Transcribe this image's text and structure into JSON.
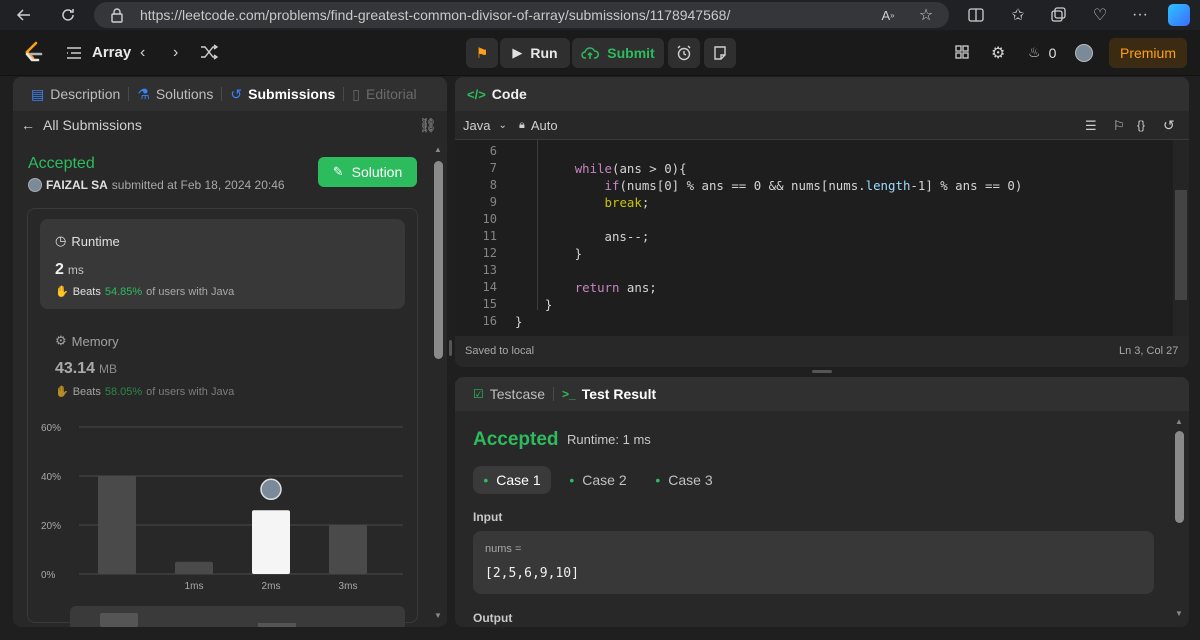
{
  "browser": {
    "url": "https://leetcode.com/problems/find-greatest-common-divisor-of-array/submissions/1178947568/"
  },
  "topbar": {
    "problem_list": "Array",
    "run_label": "Run",
    "submit_label": "Submit",
    "streak_count": "0",
    "premium_label": "Premium"
  },
  "left_tabs": [
    {
      "label": "Description"
    },
    {
      "label": "Solutions"
    },
    {
      "label": "Submissions"
    },
    {
      "label": "Editorial"
    }
  ],
  "submission": {
    "all_label": "All Submissions",
    "status": "Accepted",
    "user": "FAIZAL SA",
    "submitted_at": "submitted at Feb 18, 2024 20:46",
    "solution_label": "Solution"
  },
  "runtime": {
    "label": "Runtime",
    "value": "2",
    "unit": "ms",
    "beats_label": "Beats",
    "beats_pct": "54.85%",
    "beats_suffix": "of users with Java"
  },
  "memory": {
    "label": "Memory",
    "value": "43.14",
    "unit": "MB",
    "beats_label": "Beats",
    "beats_pct": "58.05%",
    "beats_suffix": "of users with Java"
  },
  "chart_data": {
    "type": "bar",
    "categories": [
      "",
      "1ms",
      "2ms",
      "3ms"
    ],
    "values": [
      40,
      5,
      26,
      20
    ],
    "ylim": [
      0,
      60
    ],
    "yticks": [
      "0%",
      "20%",
      "40%",
      "60%"
    ],
    "highlight_index": 2,
    "grid": true
  },
  "code_panel": {
    "title": "Code",
    "language": "Java",
    "auto_label": "Auto",
    "saved_label": "Saved to local",
    "cursor_pos": "Ln 3, Col 27",
    "lines": [
      {
        "n": "6",
        "t": ""
      },
      {
        "n": "7",
        "t": "        while(ans > 0){"
      },
      {
        "n": "8",
        "t": "            if(nums[0] % ans == 0 && nums[nums.length-1] % ans == 0)"
      },
      {
        "n": "9",
        "t": "            break;"
      },
      {
        "n": "10",
        "t": ""
      },
      {
        "n": "11",
        "t": "            ans--;"
      },
      {
        "n": "12",
        "t": "        }"
      },
      {
        "n": "13",
        "t": ""
      },
      {
        "n": "14",
        "t": "        return ans;"
      },
      {
        "n": "15",
        "t": "    }"
      },
      {
        "n": "16",
        "t": "}"
      }
    ]
  },
  "result_panel": {
    "testcase_tab": "Testcase",
    "result_tab": "Test Result",
    "status": "Accepted",
    "runtime": "Runtime: 1 ms",
    "cases": [
      "Case 1",
      "Case 2",
      "Case 3"
    ],
    "input_label": "Input",
    "var_name": "nums =",
    "var_value": "[2,5,6,9,10]",
    "output_label": "Output"
  }
}
